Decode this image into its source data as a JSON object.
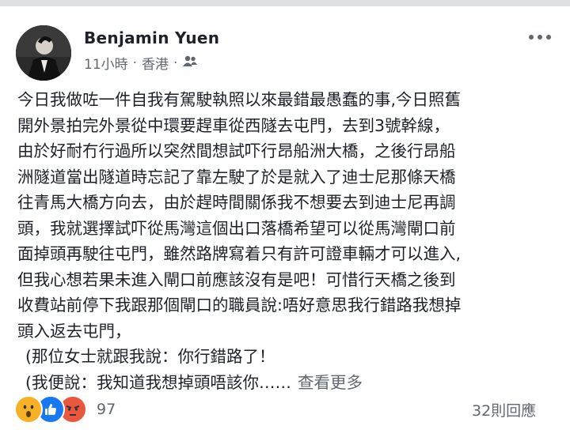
{
  "post": {
    "author": "Benjamin Yuen",
    "time": "11小時",
    "separator": "·",
    "location": "香港",
    "privacy_icon": "friends-icon",
    "lines": [
      "今日我做咗一件自我有駕駛執照以來最錯最愚蠢的事,今日照舊",
      "開外景拍完外景從中環要趕車從西隧去屯門，去到3號幹線，",
      "由於好耐冇行過所以突然間想試吓行昂船洲大橋，之後行昂船",
      "洲隧道當出隧道時忘記了靠左駛了於是就入了迪士尼那條天橋",
      "往青馬大橋方向去，由於趕時間關係我不想要去到迪士尼再調",
      "頭，我就選擇試吓從馬灣這個出口落橋希望可以從馬灣閘口前",
      "面掉頭再駛往屯門，雖然路牌寫着只有許可證車輛才可以進入,",
      "但我心想若果未進入閘口前應該沒有是吧！可惜行天橋之後到",
      "收費站前停下我跟那個閘口的職員說:唔好意思我行錯路我想掉",
      "頭入返去屯門，"
    ],
    "indent_lines": [
      "(那位女士就跟我說：你行錯路了！",
      "(我便說：我知道我想掉頭唔該你……"
    ],
    "see_more": "查看更多",
    "reaction_count": "97",
    "comment_count": "32則回應"
  },
  "colors": {
    "link_grey": "#606770",
    "like_blue": "#1877f2",
    "angry_red": "#e9573f",
    "wow_yellow": "#f7b125"
  }
}
